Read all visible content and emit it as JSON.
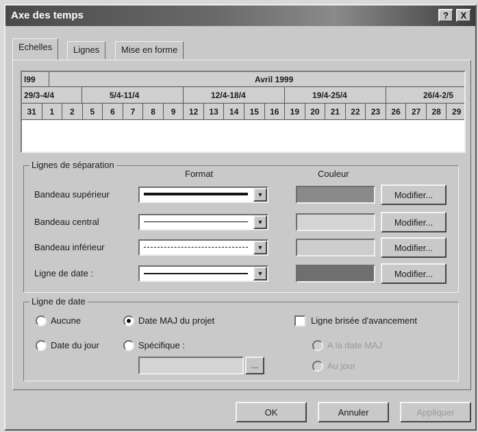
{
  "window": {
    "title": "Axe des temps",
    "help_glyph": "?",
    "close_glyph": "X"
  },
  "tabs": [
    {
      "label": "Echelles"
    },
    {
      "label": "Lignes"
    },
    {
      "label": "Mise en forme"
    }
  ],
  "timescale": {
    "top_left": "l99",
    "top_month": "Avril 1999",
    "weeks": [
      "29/3-4/4",
      "5/4-11/4",
      "12/4-18/4",
      "19/4-25/4",
      "26/4-2/5"
    ],
    "days": [
      "31",
      "1",
      "2",
      "5",
      "6",
      "7",
      "8",
      "9",
      "12",
      "13",
      "14",
      "15",
      "16",
      "19",
      "20",
      "21",
      "22",
      "23",
      "26",
      "27",
      "28",
      "29"
    ]
  },
  "separators": {
    "legend": "Lignes de séparation",
    "format_header": "Format",
    "color_header": "Couleur",
    "rows": [
      {
        "label": "Bandeau supérieur",
        "button": "Modifier..."
      },
      {
        "label": "Bandeau central",
        "button": "Modifier..."
      },
      {
        "label": "Bandeau inférieur",
        "button": "Modifier..."
      },
      {
        "label": "Ligne de date :",
        "button": "Modifier..."
      }
    ]
  },
  "date_line": {
    "legend": "Ligne de date",
    "options": [
      {
        "label": "Aucune",
        "checked": false
      },
      {
        "label": "Date MAJ du projet",
        "checked": true
      },
      {
        "label": "Date du jour",
        "checked": false
      },
      {
        "label": "Spécifique :",
        "checked": false
      }
    ],
    "date_value": "",
    "date_button": "..."
  },
  "alt_line": {
    "label": "Ligne brisée d'avancement",
    "checked": false,
    "sub_options": [
      "A la date MAJ",
      "Au jour"
    ]
  },
  "footer": {
    "ok": "OK",
    "cancel": "Annuler",
    "apply": "Appliquer"
  },
  "colors": {
    "band_top_color": "#8a8a8a",
    "band_mid_color": "#d4d4d4",
    "band_bottom_color": "#cdcdcd",
    "date_line_color": "#6f6f6f"
  }
}
